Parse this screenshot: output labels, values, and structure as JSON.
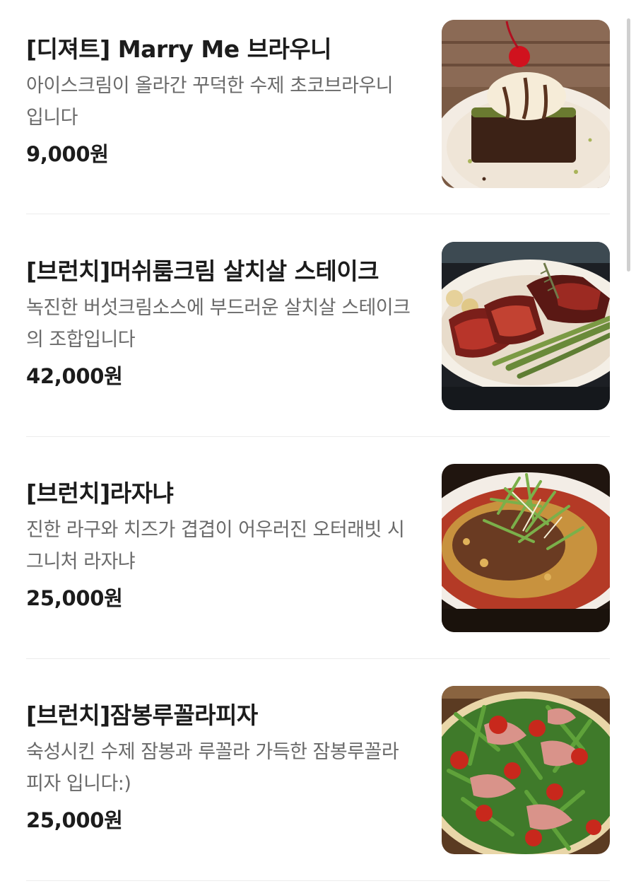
{
  "menu": {
    "items": [
      {
        "title": "[디져트] Marry Me 브라우니",
        "description": "아이스크림이 올라간 꾸덕한 수제 초코브라우니 입니다",
        "price": "9,000원",
        "photo_icon": "brownie-photo"
      },
      {
        "title": "[브런치]머쉬룸크림 살치살 스테이크",
        "description": "녹진한 버섯크림소스에 부드러운 살치살 스테이크의 조합입니다",
        "price": "42,000원",
        "photo_icon": "steak-photo"
      },
      {
        "title": "[브런치]라자냐",
        "description": "진한 라구와 치즈가 겹겹이 어우러진 오터래빗 시그니처 라자냐",
        "price": "25,000원",
        "photo_icon": "lasagna-photo"
      },
      {
        "title": "[브런치]잠봉루꼴라피자",
        "description": "숙성시킨 수제 잠봉과 루꼴라 가득한 잠봉루꼴라피자 입니다:)",
        "price": "25,000원",
        "photo_icon": "pizza-photo"
      }
    ]
  }
}
